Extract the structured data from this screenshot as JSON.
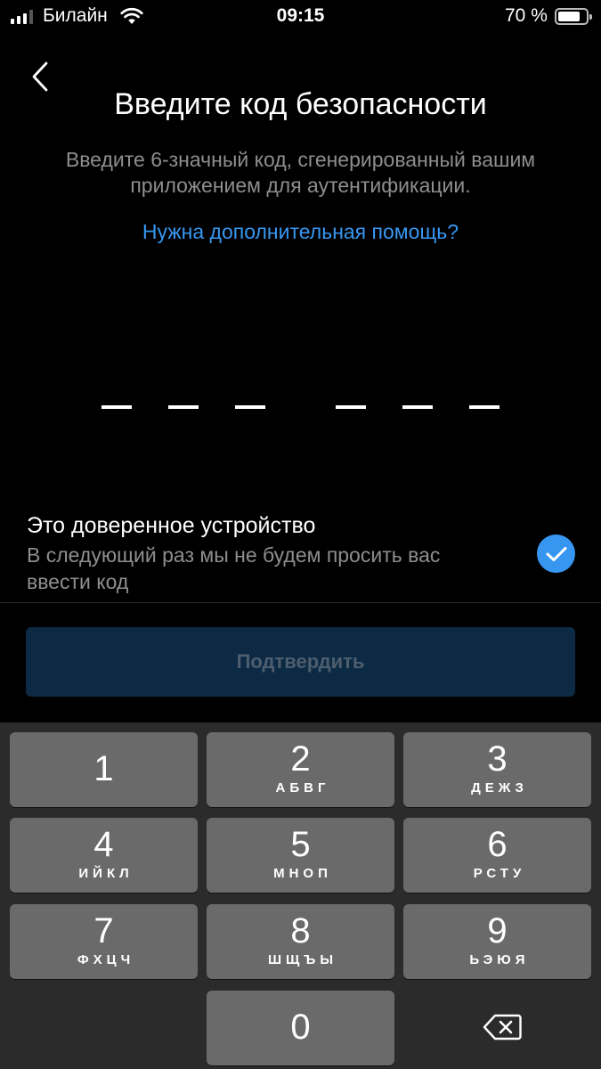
{
  "status_bar": {
    "carrier": "Билайн",
    "time": "09:15",
    "battery_percent": "70 %",
    "battery_level": 0.7,
    "signal_bars": 3
  },
  "header": {
    "title": "Введите код безопасности",
    "subtitle": "Введите 6-значный код, сгенерированный вашим приложением для аутентификации.",
    "help_link": "Нужна дополнительная помощь?"
  },
  "code": {
    "length": 6,
    "entered": ""
  },
  "trusted_device": {
    "title": "Это доверенное устройство",
    "description": "В следующий раз мы не будем просить вас ввести код",
    "checked": true
  },
  "confirm_button": {
    "label": "Подтвердить",
    "enabled": false
  },
  "keypad": {
    "keys": [
      {
        "digit": "1",
        "letters": ""
      },
      {
        "digit": "2",
        "letters": "АБВГ"
      },
      {
        "digit": "3",
        "letters": "ДЕЖЗ"
      },
      {
        "digit": "4",
        "letters": "ИЙКЛ"
      },
      {
        "digit": "5",
        "letters": "МНОП"
      },
      {
        "digit": "6",
        "letters": "РСТУ"
      },
      {
        "digit": "7",
        "letters": "ФХЦЧ"
      },
      {
        "digit": "8",
        "letters": "ШЩЪЫ"
      },
      {
        "digit": "9",
        "letters": "ЬЭЮЯ"
      },
      {
        "digit": "0",
        "letters": ""
      }
    ]
  },
  "icons": {
    "back": "chevron-left-icon",
    "check": "checkmark-icon",
    "backspace": "backspace-icon",
    "wifi": "wifi-icon"
  },
  "colors": {
    "accent": "#3797f0",
    "background": "#000000",
    "confirm_disabled_bg": "#0d2a45",
    "keypad_bg": "#2b2b2b",
    "key_bg": "#6a6a6a"
  }
}
